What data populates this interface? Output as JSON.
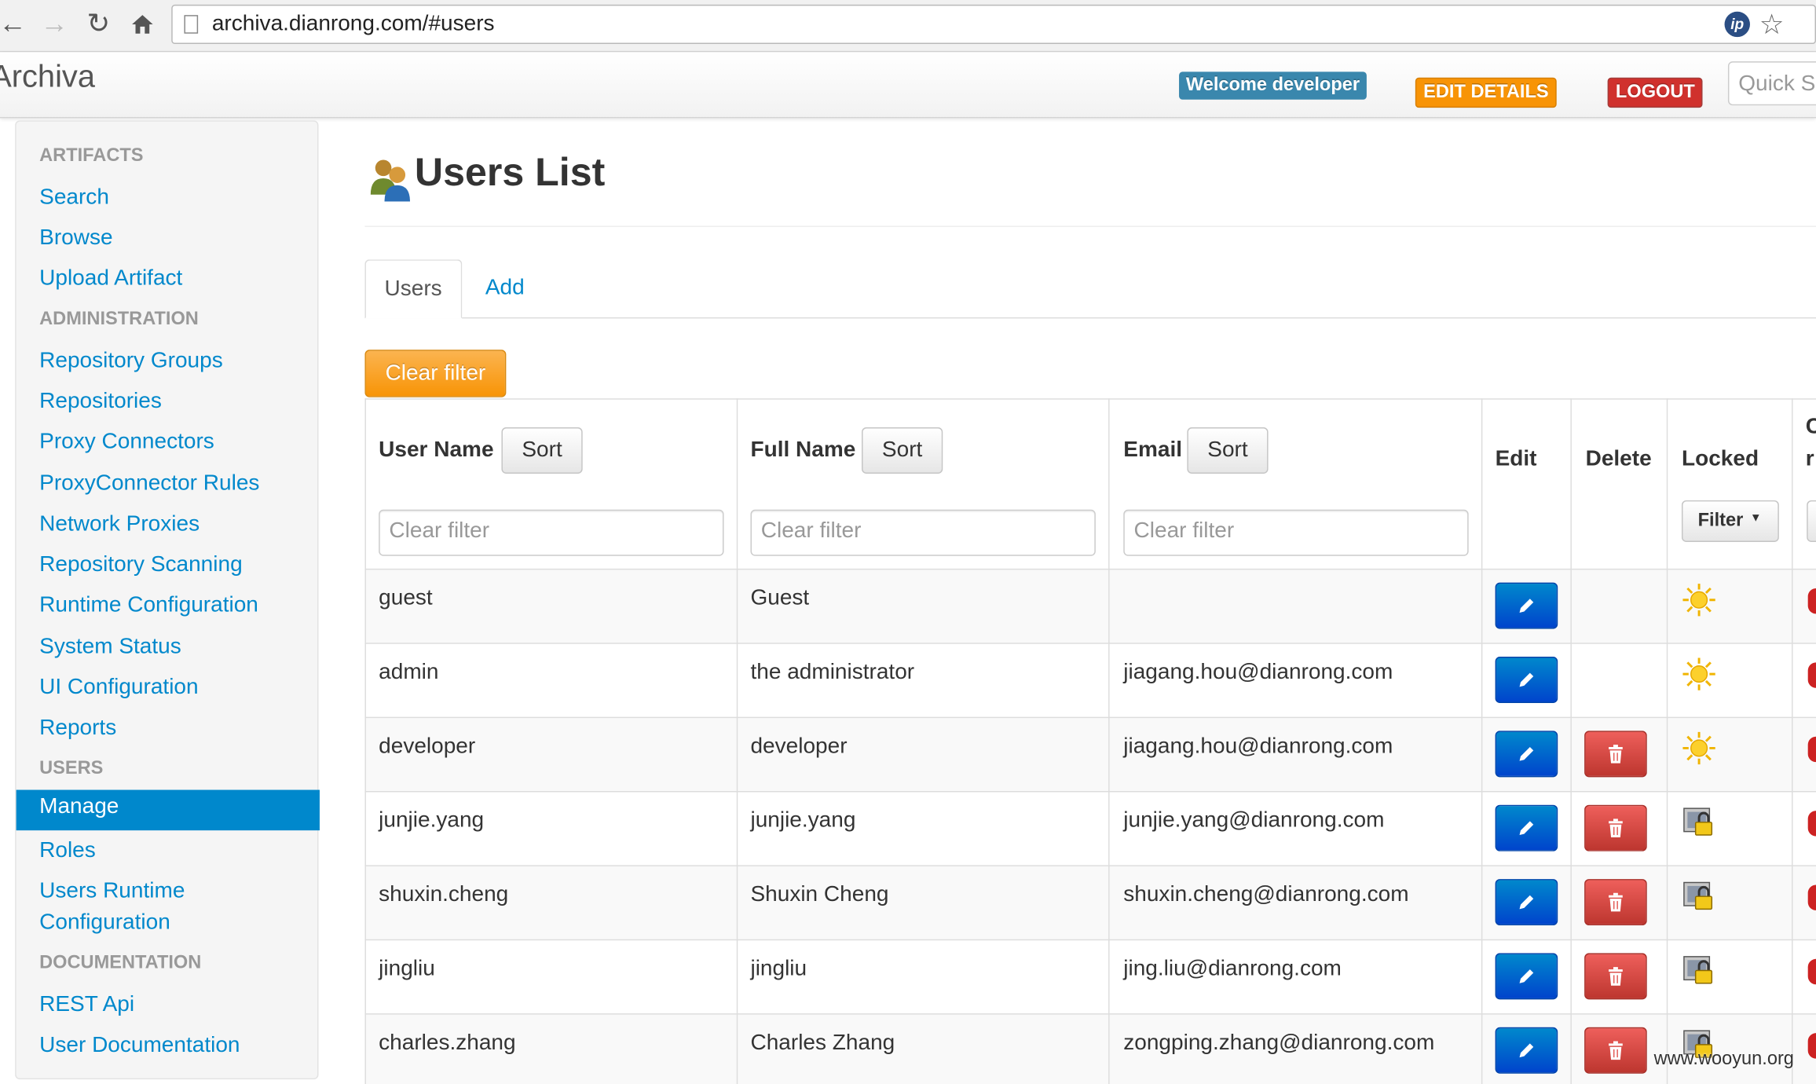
{
  "browser": {
    "url": "archiva.dianrong.com/#users"
  },
  "app": {
    "brand": "Archiva"
  },
  "header": {
    "welcome": "Welcome developer",
    "edit_details": "EDIT DETAILS",
    "logout": "LOGOUT",
    "quick_search_placeholder": "Quick Search"
  },
  "sidebar": {
    "artifacts_header": "ARTIFACTS",
    "search": "Search",
    "browse": "Browse",
    "upload": "Upload Artifact",
    "admin_header": "ADMINISTRATION",
    "repo_groups": "Repository Groups",
    "repositories": "Repositories",
    "proxy_connectors": "Proxy Connectors",
    "proxy_rules": "ProxyConnector Rules",
    "network_proxies": "Network Proxies",
    "repo_scanning": "Repository Scanning",
    "runtime_config": "Runtime Configuration",
    "system_status": "System Status",
    "ui_config": "UI Configuration",
    "reports": "Reports",
    "users_header": "USERS",
    "manage": "Manage",
    "roles": "Roles",
    "users_runtime_1": "Users Runtime",
    "users_runtime_2": "Configuration",
    "doc_header": "DOCUMENTATION",
    "rest_api": "REST Api",
    "user_doc": "User Documentation"
  },
  "main": {
    "title": "Users List",
    "tab_users": "Users",
    "tab_add": "Add",
    "clear_filter": "Clear filter"
  },
  "table": {
    "headers": {
      "username": "User Name",
      "fullname": "Full Name",
      "email": "Email",
      "edit": "Edit",
      "delete": "Delete",
      "locked": "Locked",
      "cut_1": "C",
      "cut_2": "r"
    },
    "sort_label": "Sort",
    "filter_placeholder": "Clear filter",
    "filter_dropdown": "Filter",
    "rows": [
      {
        "username": "guest",
        "fullname": "Guest",
        "email": "",
        "locked": false
      },
      {
        "username": "admin",
        "fullname": "the administrator",
        "email": "jiagang.hou@dianrong.com",
        "locked": false
      },
      {
        "username": "developer",
        "fullname": "developer",
        "email": "jiagang.hou@dianrong.com",
        "locked": false
      },
      {
        "username": "junjie.yang",
        "fullname": "junjie.yang",
        "email": "junjie.yang@dianrong.com",
        "locked": true
      },
      {
        "username": "shuxin.cheng",
        "fullname": "Shuxin Cheng",
        "email": "shuxin.cheng@dianrong.com",
        "locked": true
      },
      {
        "username": "jingliu",
        "fullname": "jingliu",
        "email": "jing.liu@dianrong.com",
        "locked": true
      },
      {
        "username": "charles.zhang",
        "fullname": "Charles Zhang",
        "email": "zongping.zhang@dianrong.com",
        "locked": true
      }
    ]
  },
  "watermark": "www.wooyun.org",
  "colors": {
    "link": "#0088cc",
    "edit": "#0044cc",
    "delete": "#bd362f",
    "warning": "#f89406"
  }
}
